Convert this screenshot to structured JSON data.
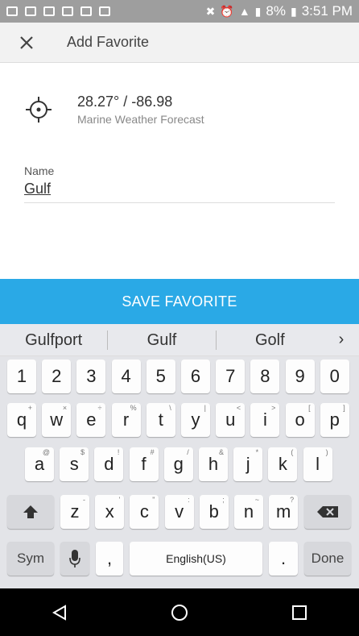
{
  "status": {
    "battery": "8%",
    "time": "3:51 PM"
  },
  "appbar": {
    "title": "Add Favorite"
  },
  "location": {
    "coords": "28.27° / -86.98",
    "subtitle": "Marine Weather Forecast"
  },
  "name_field": {
    "label": "Name",
    "value": "Gulf"
  },
  "save_button": "SAVE FAVORITE",
  "keyboard": {
    "suggestions": [
      "Gulfport",
      "Gulf",
      "Golf"
    ],
    "number_row": [
      "1",
      "2",
      "3",
      "4",
      "5",
      "6",
      "7",
      "8",
      "9",
      "0"
    ],
    "row1": [
      {
        "k": "q",
        "h": "+"
      },
      {
        "k": "w",
        "h": "×"
      },
      {
        "k": "e",
        "h": "÷"
      },
      {
        "k": "r",
        "h": "%"
      },
      {
        "k": "t",
        "h": "\\"
      },
      {
        "k": "y",
        "h": "|"
      },
      {
        "k": "u",
        "h": "<"
      },
      {
        "k": "i",
        "h": ">"
      },
      {
        "k": "o",
        "h": "["
      },
      {
        "k": "p",
        "h": "]"
      }
    ],
    "row2": [
      {
        "k": "a",
        "h": "@"
      },
      {
        "k": "s",
        "h": "$"
      },
      {
        "k": "d",
        "h": "!"
      },
      {
        "k": "f",
        "h": "#"
      },
      {
        "k": "g",
        "h": "/"
      },
      {
        "k": "h",
        "h": "&"
      },
      {
        "k": "j",
        "h": "*"
      },
      {
        "k": "k",
        "h": "("
      },
      {
        "k": "l",
        "h": ")"
      }
    ],
    "row3": [
      {
        "k": "z",
        "h": "-"
      },
      {
        "k": "x",
        "h": "'"
      },
      {
        "k": "c",
        "h": "\""
      },
      {
        "k": "v",
        "h": ":"
      },
      {
        "k": "b",
        "h": ";"
      },
      {
        "k": "n",
        "h": "~"
      },
      {
        "k": "m",
        "h": "?"
      }
    ],
    "sym": "Sym",
    "comma": ",",
    "space": "English(US)",
    "period": ".",
    "done": "Done"
  }
}
